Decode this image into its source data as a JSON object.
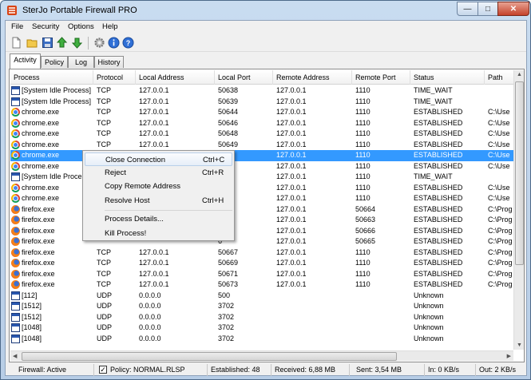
{
  "window": {
    "title": "SterJo Portable Firewall PRO",
    "caption_buttons": {
      "minimize": "—",
      "maximize": "□",
      "close": "✕"
    }
  },
  "menu": [
    "File",
    "Security",
    "Options",
    "Help"
  ],
  "toolbar_icons": [
    "new-icon",
    "open-icon",
    "save-icon",
    "arrow-up-icon",
    "arrow-down-icon",
    "gear-icon",
    "info-icon",
    "help-icon"
  ],
  "tabs": [
    {
      "label": "Activity",
      "active": true
    },
    {
      "label": "Policy",
      "active": false
    },
    {
      "label": "Log",
      "active": false
    },
    {
      "label": "History",
      "active": false
    }
  ],
  "table": {
    "columns": [
      "Process",
      "Protocol",
      "Local Address",
      "Local Port",
      "Remote Address",
      "Remote Port",
      "Status",
      "Path"
    ],
    "rows": [
      {
        "icon": "system",
        "process": "[System Idle Process]",
        "protocol": "TCP",
        "local_address": "127.0.0.1",
        "local_port": "50638",
        "remote_address": "127.0.0.1",
        "remote_port": "1110",
        "status": "TIME_WAIT",
        "path": ""
      },
      {
        "icon": "system",
        "process": "[System Idle Process]",
        "protocol": "TCP",
        "local_address": "127.0.0.1",
        "local_port": "50639",
        "remote_address": "127.0.0.1",
        "remote_port": "1110",
        "status": "TIME_WAIT",
        "path": ""
      },
      {
        "icon": "chrome",
        "process": "chrome.exe",
        "protocol": "TCP",
        "local_address": "127.0.0.1",
        "local_port": "50644",
        "remote_address": "127.0.0.1",
        "remote_port": "1110",
        "status": "ESTABLISHED",
        "path": "C:\\Use"
      },
      {
        "icon": "chrome",
        "process": "chrome.exe",
        "protocol": "TCP",
        "local_address": "127.0.0.1",
        "local_port": "50646",
        "remote_address": "127.0.0.1",
        "remote_port": "1110",
        "status": "ESTABLISHED",
        "path": "C:\\Use"
      },
      {
        "icon": "chrome",
        "process": "chrome.exe",
        "protocol": "TCP",
        "local_address": "127.0.0.1",
        "local_port": "50648",
        "remote_address": "127.0.0.1",
        "remote_port": "1110",
        "status": "ESTABLISHED",
        "path": "C:\\Use"
      },
      {
        "icon": "chrome",
        "process": "chrome.exe",
        "protocol": "TCP",
        "local_address": "127.0.0.1",
        "local_port": "50649",
        "remote_address": "127.0.0.1",
        "remote_port": "1110",
        "status": "ESTABLISHED",
        "path": "C:\\Use"
      },
      {
        "icon": "chrome",
        "process": "chrome.exe",
        "protocol": "",
        "local_address": "",
        "local_port": "1",
        "remote_address": "127.0.0.1",
        "remote_port": "1110",
        "status": "ESTABLISHED",
        "path": "C:\\Use",
        "selected": true
      },
      {
        "icon": "chrome",
        "process": "chrome.exe",
        "protocol": "",
        "local_address": "",
        "local_port": "2",
        "remote_address": "127.0.0.1",
        "remote_port": "1110",
        "status": "ESTABLISHED",
        "path": "C:\\Use"
      },
      {
        "icon": "system",
        "process": "[System Idle Proce",
        "protocol": "",
        "local_address": "",
        "local_port": "3",
        "remote_address": "127.0.0.1",
        "remote_port": "1110",
        "status": "TIME_WAIT",
        "path": ""
      },
      {
        "icon": "chrome",
        "process": "chrome.exe",
        "protocol": "",
        "local_address": "",
        "local_port": "8",
        "remote_address": "127.0.0.1",
        "remote_port": "1110",
        "status": "ESTABLISHED",
        "path": "C:\\Use"
      },
      {
        "icon": "chrome",
        "process": "chrome.exe",
        "protocol": "",
        "local_address": "",
        "local_port": "8",
        "remote_address": "127.0.0.1",
        "remote_port": "1110",
        "status": "ESTABLISHED",
        "path": "C:\\Use"
      },
      {
        "icon": "firefox",
        "process": "firefox.exe",
        "protocol": "",
        "local_address": "",
        "local_port": "3",
        "remote_address": "127.0.0.1",
        "remote_port": "50664",
        "status": "ESTABLISHED",
        "path": "C:\\Prog"
      },
      {
        "icon": "firefox",
        "process": "firefox.exe",
        "protocol": "",
        "local_address": "",
        "local_port": "4",
        "remote_address": "127.0.0.1",
        "remote_port": "50663",
        "status": "ESTABLISHED",
        "path": "C:\\Prog"
      },
      {
        "icon": "firefox",
        "process": "firefox.exe",
        "protocol": "",
        "local_address": "",
        "local_port": "5",
        "remote_address": "127.0.0.1",
        "remote_port": "50666",
        "status": "ESTABLISHED",
        "path": "C:\\Prog"
      },
      {
        "icon": "firefox",
        "process": "firefox.exe",
        "protocol": "",
        "local_address": "",
        "local_port": "6",
        "remote_address": "127.0.0.1",
        "remote_port": "50665",
        "status": "ESTABLISHED",
        "path": "C:\\Prog"
      },
      {
        "icon": "firefox",
        "process": "firefox.exe",
        "protocol": "TCP",
        "local_address": "127.0.0.1",
        "local_port": "50667",
        "remote_address": "127.0.0.1",
        "remote_port": "1110",
        "status": "ESTABLISHED",
        "path": "C:\\Prog"
      },
      {
        "icon": "firefox",
        "process": "firefox.exe",
        "protocol": "TCP",
        "local_address": "127.0.0.1",
        "local_port": "50669",
        "remote_address": "127.0.0.1",
        "remote_port": "1110",
        "status": "ESTABLISHED",
        "path": "C:\\Prog"
      },
      {
        "icon": "firefox",
        "process": "firefox.exe",
        "protocol": "TCP",
        "local_address": "127.0.0.1",
        "local_port": "50671",
        "remote_address": "127.0.0.1",
        "remote_port": "1110",
        "status": "ESTABLISHED",
        "path": "C:\\Prog"
      },
      {
        "icon": "firefox",
        "process": "firefox.exe",
        "protocol": "TCP",
        "local_address": "127.0.0.1",
        "local_port": "50673",
        "remote_address": "127.0.0.1",
        "remote_port": "1110",
        "status": "ESTABLISHED",
        "path": "C:\\Prog"
      },
      {
        "icon": "system",
        "process": "[112]",
        "protocol": "UDP",
        "local_address": "0.0.0.0",
        "local_port": "500",
        "remote_address": "",
        "remote_port": "",
        "status": "Unknown",
        "path": ""
      },
      {
        "icon": "system",
        "process": "[1512]",
        "protocol": "UDP",
        "local_address": "0.0.0.0",
        "local_port": "3702",
        "remote_address": "",
        "remote_port": "",
        "status": "Unknown",
        "path": ""
      },
      {
        "icon": "system",
        "process": "[1512]",
        "protocol": "UDP",
        "local_address": "0.0.0.0",
        "local_port": "3702",
        "remote_address": "",
        "remote_port": "",
        "status": "Unknown",
        "path": ""
      },
      {
        "icon": "system",
        "process": "[1048]",
        "protocol": "UDP",
        "local_address": "0.0.0.0",
        "local_port": "3702",
        "remote_address": "",
        "remote_port": "",
        "status": "Unknown",
        "path": ""
      },
      {
        "icon": "system",
        "process": "[1048]",
        "protocol": "UDP",
        "local_address": "0.0.0.0",
        "local_port": "3702",
        "remote_address": "",
        "remote_port": "",
        "status": "Unknown",
        "path": ""
      }
    ]
  },
  "context_menu": [
    {
      "label": "Close Connection",
      "shortcut": "Ctrl+C",
      "highlighted": true
    },
    {
      "label": "Reject",
      "shortcut": "Ctrl+R"
    },
    {
      "label": "Copy Remote Address",
      "shortcut": ""
    },
    {
      "label": "Resolve Host",
      "shortcut": "Ctrl+H"
    },
    {
      "separator": true
    },
    {
      "label": "Process Details...",
      "shortcut": ""
    },
    {
      "label": "Kill Process!",
      "shortcut": ""
    }
  ],
  "statusbar": {
    "firewall": "Firewall: Active",
    "policy": "Policy: NORMAL.RLSP",
    "policy_checked": true,
    "established": "Established: 48",
    "received": "Received: 6,88 MB",
    "sent": "Sent: 3,54 MB",
    "in_rate": "In: 0 KB/s",
    "out_rate": "Out: 2 KB/s"
  },
  "colors": {
    "selection": "#3399ff",
    "title_gradient": "#c9dcf0",
    "close_button": "#c4422b"
  }
}
